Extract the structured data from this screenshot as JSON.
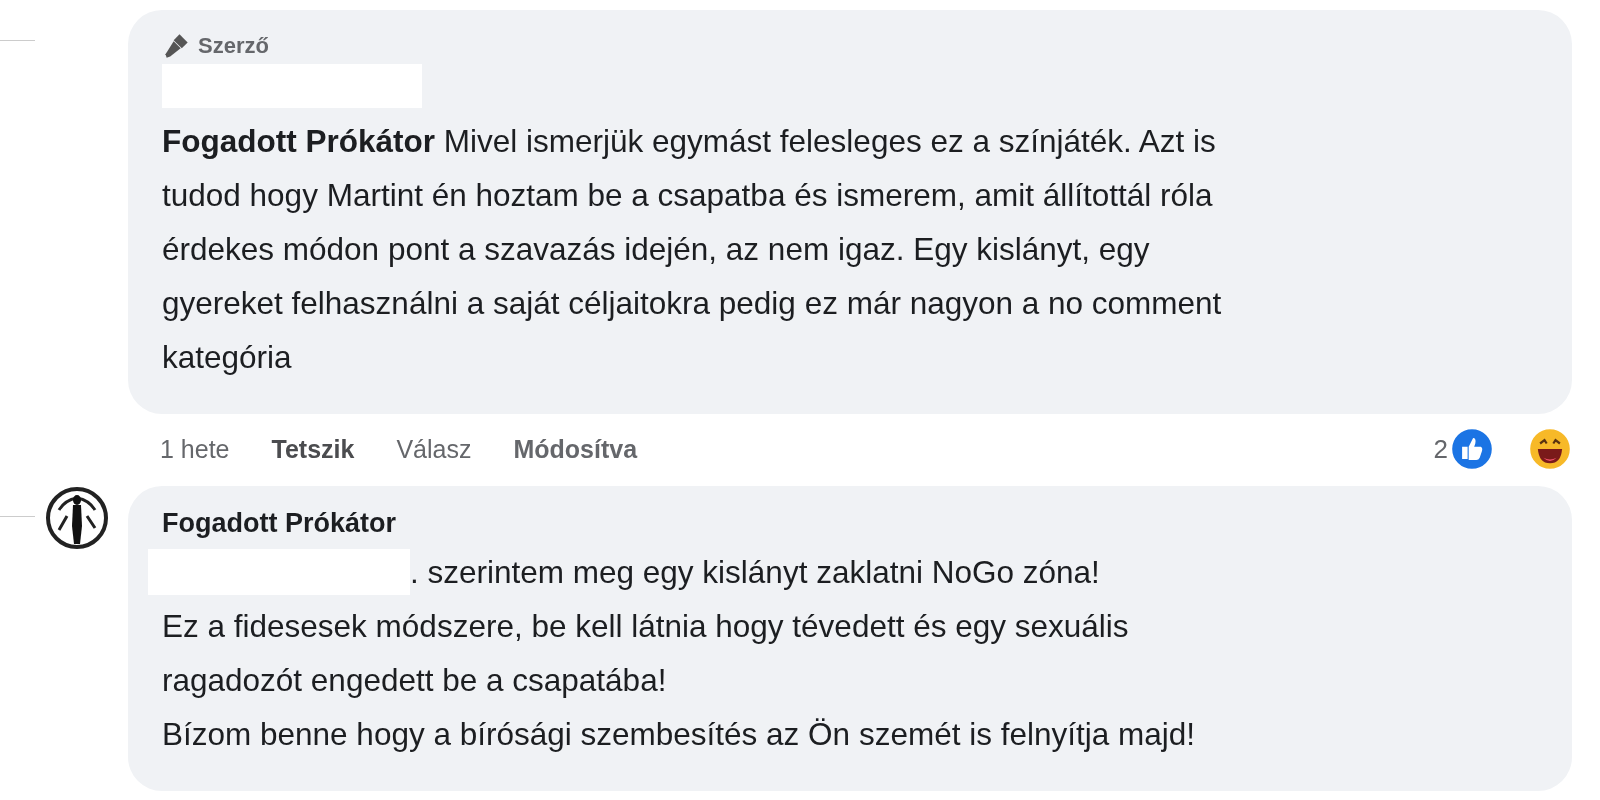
{
  "comments": [
    {
      "badge": "Szerző",
      "name_hidden": true,
      "text": "**Fogadott Prókátor** Mivel ismerjük egymást felesleges ez a színjáték. Azt is\ntudod hogy Martint én hoztam be a csapatba és ismerem, amit állítottál róla\nérdekes módon pont a szavazás idején, az nem igaz. Egy kislányt, egy\ngyereket felhasználni a saját céljaitokra pedig ez már nagyon a no comment\nkategória",
      "footer": {
        "time": "1 hete",
        "actions": [
          {
            "label": "Tetszik",
            "kind": "like"
          },
          {
            "label": "Válasz",
            "kind": "reply"
          }
        ],
        "edited": "Módosítva",
        "reaction_count": "2",
        "reactions": [
          {
            "kind": "like"
          },
          {
            "kind": "haha"
          }
        ]
      }
    },
    {
      "author": "Fogadott Prókátor",
      "mention_hidden": true,
      "mention_line": ". szerintem meg egy kislányt zaklatni NoGo zóna!",
      "text": "Ez a fidesesek módszere, be kell látnia hogy tévedett és egy sexuális\nragadozót engedett be a csapatába!\nBízom benne hogy a bírósági szembesítés az Ön szemét is felnyítja majd!"
    }
  ]
}
